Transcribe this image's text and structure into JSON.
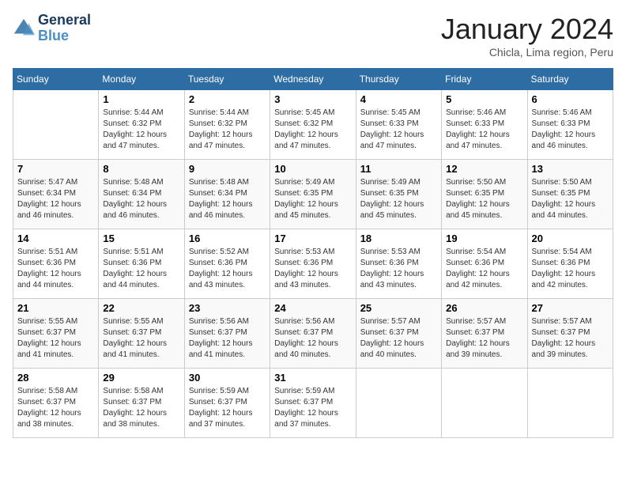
{
  "header": {
    "logo_line1": "General",
    "logo_line2": "Blue",
    "month_title": "January 2024",
    "subtitle": "Chicla, Lima region, Peru"
  },
  "days_of_week": [
    "Sunday",
    "Monday",
    "Tuesday",
    "Wednesday",
    "Thursday",
    "Friday",
    "Saturday"
  ],
  "weeks": [
    [
      {
        "day": "",
        "info": ""
      },
      {
        "day": "1",
        "info": "Sunrise: 5:44 AM\nSunset: 6:32 PM\nDaylight: 12 hours\nand 47 minutes."
      },
      {
        "day": "2",
        "info": "Sunrise: 5:44 AM\nSunset: 6:32 PM\nDaylight: 12 hours\nand 47 minutes."
      },
      {
        "day": "3",
        "info": "Sunrise: 5:45 AM\nSunset: 6:32 PM\nDaylight: 12 hours\nand 47 minutes."
      },
      {
        "day": "4",
        "info": "Sunrise: 5:45 AM\nSunset: 6:33 PM\nDaylight: 12 hours\nand 47 minutes."
      },
      {
        "day": "5",
        "info": "Sunrise: 5:46 AM\nSunset: 6:33 PM\nDaylight: 12 hours\nand 47 minutes."
      },
      {
        "day": "6",
        "info": "Sunrise: 5:46 AM\nSunset: 6:33 PM\nDaylight: 12 hours\nand 46 minutes."
      }
    ],
    [
      {
        "day": "7",
        "info": "Sunrise: 5:47 AM\nSunset: 6:34 PM\nDaylight: 12 hours\nand 46 minutes."
      },
      {
        "day": "8",
        "info": "Sunrise: 5:48 AM\nSunset: 6:34 PM\nDaylight: 12 hours\nand 46 minutes."
      },
      {
        "day": "9",
        "info": "Sunrise: 5:48 AM\nSunset: 6:34 PM\nDaylight: 12 hours\nand 46 minutes."
      },
      {
        "day": "10",
        "info": "Sunrise: 5:49 AM\nSunset: 6:35 PM\nDaylight: 12 hours\nand 45 minutes."
      },
      {
        "day": "11",
        "info": "Sunrise: 5:49 AM\nSunset: 6:35 PM\nDaylight: 12 hours\nand 45 minutes."
      },
      {
        "day": "12",
        "info": "Sunrise: 5:50 AM\nSunset: 6:35 PM\nDaylight: 12 hours\nand 45 minutes."
      },
      {
        "day": "13",
        "info": "Sunrise: 5:50 AM\nSunset: 6:35 PM\nDaylight: 12 hours\nand 44 minutes."
      }
    ],
    [
      {
        "day": "14",
        "info": "Sunrise: 5:51 AM\nSunset: 6:36 PM\nDaylight: 12 hours\nand 44 minutes."
      },
      {
        "day": "15",
        "info": "Sunrise: 5:51 AM\nSunset: 6:36 PM\nDaylight: 12 hours\nand 44 minutes."
      },
      {
        "day": "16",
        "info": "Sunrise: 5:52 AM\nSunset: 6:36 PM\nDaylight: 12 hours\nand 43 minutes."
      },
      {
        "day": "17",
        "info": "Sunrise: 5:53 AM\nSunset: 6:36 PM\nDaylight: 12 hours\nand 43 minutes."
      },
      {
        "day": "18",
        "info": "Sunrise: 5:53 AM\nSunset: 6:36 PM\nDaylight: 12 hours\nand 43 minutes."
      },
      {
        "day": "19",
        "info": "Sunrise: 5:54 AM\nSunset: 6:36 PM\nDaylight: 12 hours\nand 42 minutes."
      },
      {
        "day": "20",
        "info": "Sunrise: 5:54 AM\nSunset: 6:36 PM\nDaylight: 12 hours\nand 42 minutes."
      }
    ],
    [
      {
        "day": "21",
        "info": "Sunrise: 5:55 AM\nSunset: 6:37 PM\nDaylight: 12 hours\nand 41 minutes."
      },
      {
        "day": "22",
        "info": "Sunrise: 5:55 AM\nSunset: 6:37 PM\nDaylight: 12 hours\nand 41 minutes."
      },
      {
        "day": "23",
        "info": "Sunrise: 5:56 AM\nSunset: 6:37 PM\nDaylight: 12 hours\nand 41 minutes."
      },
      {
        "day": "24",
        "info": "Sunrise: 5:56 AM\nSunset: 6:37 PM\nDaylight: 12 hours\nand 40 minutes."
      },
      {
        "day": "25",
        "info": "Sunrise: 5:57 AM\nSunset: 6:37 PM\nDaylight: 12 hours\nand 40 minutes."
      },
      {
        "day": "26",
        "info": "Sunrise: 5:57 AM\nSunset: 6:37 PM\nDaylight: 12 hours\nand 39 minutes."
      },
      {
        "day": "27",
        "info": "Sunrise: 5:57 AM\nSunset: 6:37 PM\nDaylight: 12 hours\nand 39 minutes."
      }
    ],
    [
      {
        "day": "28",
        "info": "Sunrise: 5:58 AM\nSunset: 6:37 PM\nDaylight: 12 hours\nand 38 minutes."
      },
      {
        "day": "29",
        "info": "Sunrise: 5:58 AM\nSunset: 6:37 PM\nDaylight: 12 hours\nand 38 minutes."
      },
      {
        "day": "30",
        "info": "Sunrise: 5:59 AM\nSunset: 6:37 PM\nDaylight: 12 hours\nand 37 minutes."
      },
      {
        "day": "31",
        "info": "Sunrise: 5:59 AM\nSunset: 6:37 PM\nDaylight: 12 hours\nand 37 minutes."
      },
      {
        "day": "",
        "info": ""
      },
      {
        "day": "",
        "info": ""
      },
      {
        "day": "",
        "info": ""
      }
    ]
  ]
}
